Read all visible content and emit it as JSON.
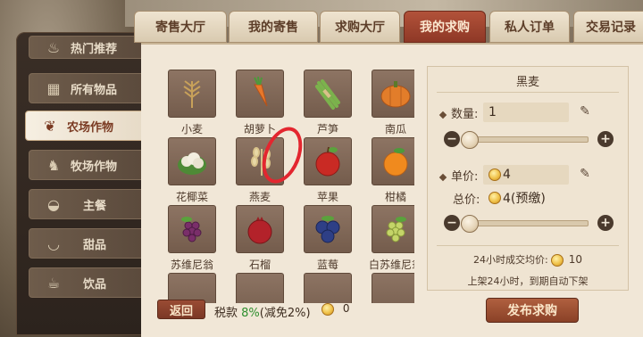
{
  "tabs": [
    {
      "label": "寄售大厅",
      "active": false
    },
    {
      "label": "我的寄售",
      "active": false
    },
    {
      "label": "求购大厅",
      "active": false
    },
    {
      "label": "我的求购",
      "active": true
    },
    {
      "label": "私人订单",
      "active": false
    },
    {
      "label": "交易记录",
      "active": false
    }
  ],
  "sidebar": {
    "items": [
      {
        "label": "热门推荐",
        "icon": "flame-icon",
        "active": false
      },
      {
        "label": "所有物品",
        "icon": "grid-icon",
        "active": false
      },
      {
        "label": "农场作物",
        "icon": "sprout-icon",
        "active": true
      },
      {
        "label": "牧场作物",
        "icon": "rooster-icon",
        "active": false
      },
      {
        "label": "主餐",
        "icon": "pot-icon",
        "active": false
      },
      {
        "label": "甜品",
        "icon": "bowl-icon",
        "active": false
      },
      {
        "label": "饮品",
        "icon": "cup-icon",
        "active": false
      }
    ]
  },
  "items": [
    {
      "name": "小麦",
      "icon": "wheat-icon"
    },
    {
      "name": "胡萝卜",
      "icon": "carrot-icon"
    },
    {
      "name": "芦笋",
      "icon": "asparagus-icon"
    },
    {
      "name": "南瓜",
      "icon": "pumpkin-icon"
    },
    {
      "name": "花椰菜",
      "icon": "cauliflower-icon"
    },
    {
      "name": "燕麦",
      "icon": "oat-icon"
    },
    {
      "name": "苹果",
      "icon": "apple-icon"
    },
    {
      "name": "柑橘",
      "icon": "orange-icon"
    },
    {
      "name": "苏维尼翁",
      "icon": "grape-purple-icon"
    },
    {
      "name": "石榴",
      "icon": "pomegranate-icon"
    },
    {
      "name": "蓝莓",
      "icon": "blueberry-icon"
    },
    {
      "name": "白苏维尼翁",
      "icon": "grape-green-icon"
    }
  ],
  "detail": {
    "title": "黑麦",
    "quantity_label": "数量:",
    "quantity_value": "1",
    "quantity_slider": 0.0,
    "unit_price_label": "单价:",
    "unit_price_value": "4",
    "total_label": "总价:",
    "total_value": "4(预缴)",
    "price_slider": 0.0,
    "volume_label": "24小时成交均价:",
    "volume_value": "10",
    "expire_note": "上架24小时，到期自动下架"
  },
  "footer": {
    "back_label": "返回",
    "tax_label": "税款",
    "tax_rate": "8%",
    "tax_reduction": "(减免2%)",
    "tax_amount": "0",
    "post_label": "发布求购"
  },
  "colors": {
    "active_tab": "#9e4630",
    "panel_bg": "#f1e7d7",
    "red_mark": "#e3262f",
    "tax_green": "#2e8f2e"
  }
}
